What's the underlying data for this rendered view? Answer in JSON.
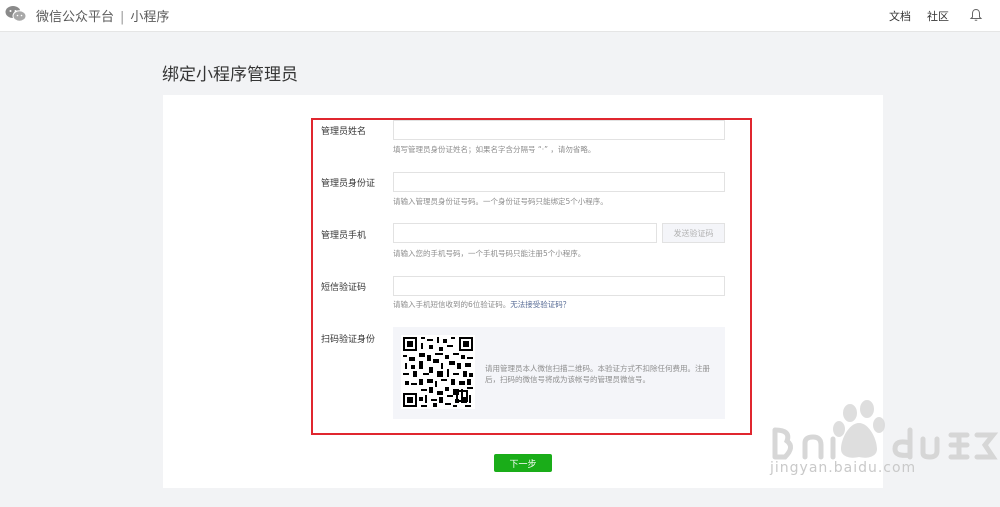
{
  "header": {
    "brand": "微信公众平台",
    "separator": "|",
    "section": "小程序",
    "nav_docs": "文档",
    "nav_community": "社区",
    "icons": {
      "logo": "wechat-logo",
      "notifications": "bell-icon"
    }
  },
  "page": {
    "title": "绑定小程序管理员"
  },
  "form": {
    "name": {
      "label": "管理员姓名",
      "value": "",
      "hint": "填写管理员身份证姓名；如果名字含分隔号 “·” ，请勿省略。"
    },
    "id_card": {
      "label": "管理员身份证",
      "value": "",
      "hint": "请输入管理员身份证号码。一个身份证号码只能绑定5个小程序。"
    },
    "phone": {
      "label": "管理员手机",
      "value": "",
      "hint": "请输入您的手机号码，一个手机号码只能注册5个小程序。",
      "send_code_button": "发送验证码"
    },
    "sms": {
      "label": "短信验证码",
      "value": "",
      "hint": "请输入手机短信收到的6位验证码。",
      "hint_link": "无法接受验证码？"
    },
    "qr": {
      "label": "扫码验证身份",
      "description": "请用管理员本人微信扫描二维码。本验证方式不扣除任何费用。注册后，扫码的微信号将成为该帐号的管理员微信号。"
    },
    "next_button": "下一步"
  },
  "watermark": {
    "text": "jingyan.baidu.com"
  },
  "colors": {
    "accent": "#1aad19",
    "highlight": "#e0262f",
    "link": "#576b95"
  }
}
